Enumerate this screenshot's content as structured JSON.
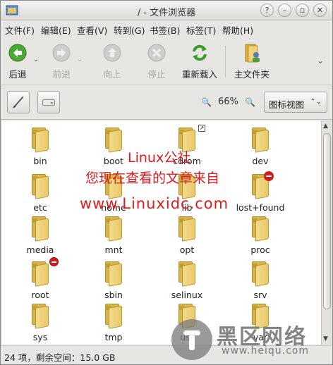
{
  "window": {
    "title": "/ - 文件浏览器",
    "controls": {
      "help": "?",
      "minimize": "–",
      "maximize": "▫",
      "close": "✕"
    }
  },
  "menu": [
    "文件(F)",
    "编辑(E)",
    "查看(V)",
    "转到(G)",
    "书签(B)",
    "标签(T)",
    "帮助(H)"
  ],
  "toolbar": {
    "back": "后退",
    "forward": "前进",
    "up": "向上",
    "stop": "停止",
    "reload": "重新载入",
    "home": "主文件夹",
    "dropdown_arrow": "⌄",
    "overflow_arrow": "⌄"
  },
  "panel": {
    "zoom_out_icon": "🔍",
    "zoom_level": "66%",
    "zoom_in_icon": "🔍",
    "view_mode": "图标视图",
    "view_mode_arrow": "⌃⌄"
  },
  "files": [
    {
      "name": "bin"
    },
    {
      "name": "boot"
    },
    {
      "name": "cdrom",
      "badge": "link"
    },
    {
      "name": "dev"
    },
    {
      "name": "etc"
    },
    {
      "name": "home"
    },
    {
      "name": "lib"
    },
    {
      "name": "lost+found"
    },
    {
      "name": "media"
    },
    {
      "name": "mnt"
    },
    {
      "name": "opt"
    },
    {
      "name": "proc"
    },
    {
      "name": "root",
      "badge": "noentry"
    },
    {
      "name": "sbin"
    },
    {
      "name": "selinux"
    },
    {
      "name": "srv"
    },
    {
      "name": "sys"
    },
    {
      "name": "tmp"
    },
    {
      "name": "usr"
    },
    {
      "name": "var"
    }
  ],
  "status": "24 项，剩余空间：15.0 GB",
  "watermark": {
    "line1": "Linux公社",
    "line2": "您现在查看的文章来自",
    "line3": "www.Linuxidc.com",
    "heiqu_cn": "黑区网络",
    "heiqu_url": "www.heiqu.com"
  },
  "colors": {
    "folder": "#e9c869",
    "watermark": "#e01a1a",
    "background": "#e8e6e2"
  }
}
